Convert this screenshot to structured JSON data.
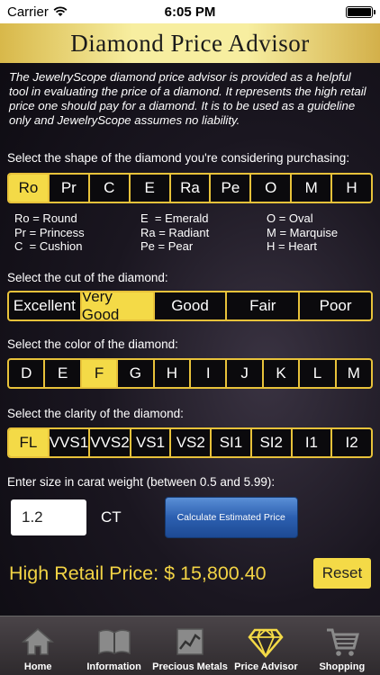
{
  "status": {
    "carrier": "Carrier",
    "time": "6:05 PM"
  },
  "header": {
    "title": "Diamond Price Advisor"
  },
  "intro": "The JewelryScope diamond price advisor is provided as a helpful tool in evaluating the price of a diamond. It represents the high retail price one should pay for a diamond. It is to be used as a guideline only and JewelryScope assumes no liability.",
  "shape": {
    "label": "Select the shape of the diamond you're considering purchasing:",
    "options": [
      "Ro",
      "Pr",
      "C",
      "E",
      "Ra",
      "Pe",
      "O",
      "M",
      "H"
    ],
    "selected": "Ro",
    "legend": [
      "Ro = Round",
      "E  = Emerald",
      "O = Oval",
      "Pr = Princess",
      "Ra = Radiant",
      "M = Marquise",
      "C  = Cushion",
      "Pe = Pear",
      "H = Heart"
    ]
  },
  "cut": {
    "label": "Select the cut of the diamond:",
    "options": [
      "Excellent",
      "Very Good",
      "Good",
      "Fair",
      "Poor"
    ],
    "selected": "Very Good"
  },
  "color": {
    "label": "Select the color of the diamond:",
    "options": [
      "D",
      "E",
      "F",
      "G",
      "H",
      "I",
      "J",
      "K",
      "L",
      "M"
    ],
    "selected": "F"
  },
  "clarity": {
    "label": "Select the clarity of the diamond:",
    "options": [
      "FL",
      "VVS1",
      "VVS2",
      "VS1",
      "VS2",
      "SI1",
      "SI2",
      "I1",
      "I2"
    ],
    "selected": "FL"
  },
  "size": {
    "label": "Enter size in carat weight (between 0.5 and 5.99):",
    "value": "1.2",
    "unit": "CT",
    "calculate_label": "Calculate Estimated Price"
  },
  "result": {
    "text": "High Retail Price: $ 15,800.40",
    "reset_label": "Reset"
  },
  "tabs": [
    {
      "label": "Home",
      "icon": "home-icon"
    },
    {
      "label": "Information",
      "icon": "book-icon"
    },
    {
      "label": "Precious Metals",
      "icon": "chart-icon"
    },
    {
      "label": "Price Advisor",
      "icon": "diamond-icon"
    },
    {
      "label": "Shopping",
      "icon": "cart-icon"
    }
  ],
  "colors": {
    "gold": "#f4da47",
    "header_gold": "#f7eea0",
    "result_gold": "#f2d345",
    "button_blue": "#2c5fb0"
  }
}
